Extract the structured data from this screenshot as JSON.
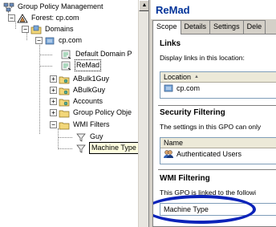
{
  "tree": {
    "root": "Group Policy Management",
    "forest": "Forest: cp.com",
    "domains": "Domains",
    "domain": "cp.com",
    "items": [
      "Default Domain P",
      "ReMad",
      "ABulk1Guy",
      "ABulkGuy",
      "Accounts",
      "Group Policy Obje",
      "WMI Filters"
    ],
    "wmi_children": [
      "Guy",
      "Machine Type"
    ]
  },
  "right": {
    "title": "ReMad",
    "tabs": [
      "Scope",
      "Details",
      "Settings",
      "Dele"
    ],
    "links": {
      "heading": "Links",
      "text": "Display links in this location:",
      "column": "Location",
      "row": "cp.com"
    },
    "security": {
      "heading": "Security Filtering",
      "text": "The settings in this GPO can only",
      "column": "Name",
      "row": "Authenticated Users"
    },
    "wmi": {
      "heading": "WMI Filtering",
      "text": "This GPO is linked to the followi",
      "value": "Machine Type"
    }
  },
  "colors": {
    "title": "#003399",
    "highlight_oval": "#0b23b9",
    "tooltip": "#ffffe1"
  },
  "icons": [
    "gpm-icon",
    "forest-icon",
    "domains-icon",
    "domain-icon",
    "gpo-link-icon",
    "ou-icon",
    "folder-icon",
    "wmi-filter-icon",
    "users-icon"
  ]
}
